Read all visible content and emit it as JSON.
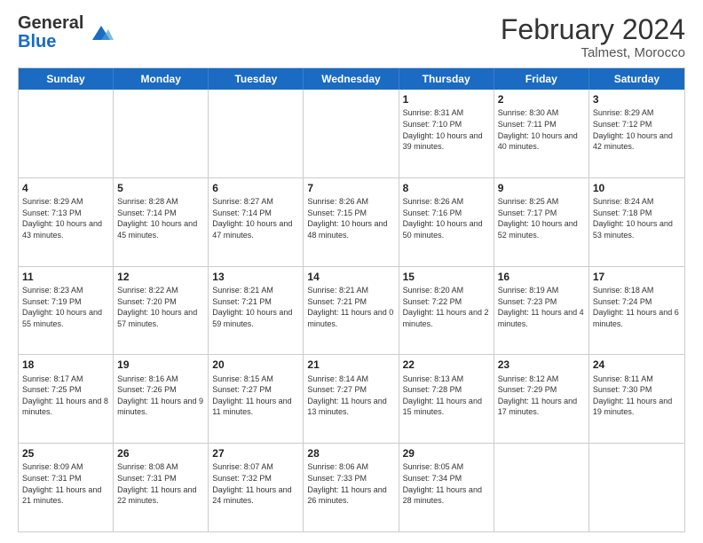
{
  "header": {
    "logo_general": "General",
    "logo_blue": "Blue",
    "title": "February 2024",
    "subtitle": "Talmest, Morocco"
  },
  "calendar": {
    "days": [
      "Sunday",
      "Monday",
      "Tuesday",
      "Wednesday",
      "Thursday",
      "Friday",
      "Saturday"
    ],
    "weeks": [
      [
        {
          "day": "",
          "info": ""
        },
        {
          "day": "",
          "info": ""
        },
        {
          "day": "",
          "info": ""
        },
        {
          "day": "",
          "info": ""
        },
        {
          "day": "1",
          "info": "Sunrise: 8:31 AM\nSunset: 7:10 PM\nDaylight: 10 hours and 39 minutes."
        },
        {
          "day": "2",
          "info": "Sunrise: 8:30 AM\nSunset: 7:11 PM\nDaylight: 10 hours and 40 minutes."
        },
        {
          "day": "3",
          "info": "Sunrise: 8:29 AM\nSunset: 7:12 PM\nDaylight: 10 hours and 42 minutes."
        }
      ],
      [
        {
          "day": "4",
          "info": "Sunrise: 8:29 AM\nSunset: 7:13 PM\nDaylight: 10 hours and 43 minutes."
        },
        {
          "day": "5",
          "info": "Sunrise: 8:28 AM\nSunset: 7:14 PM\nDaylight: 10 hours and 45 minutes."
        },
        {
          "day": "6",
          "info": "Sunrise: 8:27 AM\nSunset: 7:14 PM\nDaylight: 10 hours and 47 minutes."
        },
        {
          "day": "7",
          "info": "Sunrise: 8:26 AM\nSunset: 7:15 PM\nDaylight: 10 hours and 48 minutes."
        },
        {
          "day": "8",
          "info": "Sunrise: 8:26 AM\nSunset: 7:16 PM\nDaylight: 10 hours and 50 minutes."
        },
        {
          "day": "9",
          "info": "Sunrise: 8:25 AM\nSunset: 7:17 PM\nDaylight: 10 hours and 52 minutes."
        },
        {
          "day": "10",
          "info": "Sunrise: 8:24 AM\nSunset: 7:18 PM\nDaylight: 10 hours and 53 minutes."
        }
      ],
      [
        {
          "day": "11",
          "info": "Sunrise: 8:23 AM\nSunset: 7:19 PM\nDaylight: 10 hours and 55 minutes."
        },
        {
          "day": "12",
          "info": "Sunrise: 8:22 AM\nSunset: 7:20 PM\nDaylight: 10 hours and 57 minutes."
        },
        {
          "day": "13",
          "info": "Sunrise: 8:21 AM\nSunset: 7:21 PM\nDaylight: 10 hours and 59 minutes."
        },
        {
          "day": "14",
          "info": "Sunrise: 8:21 AM\nSunset: 7:21 PM\nDaylight: 11 hours and 0 minutes."
        },
        {
          "day": "15",
          "info": "Sunrise: 8:20 AM\nSunset: 7:22 PM\nDaylight: 11 hours and 2 minutes."
        },
        {
          "day": "16",
          "info": "Sunrise: 8:19 AM\nSunset: 7:23 PM\nDaylight: 11 hours and 4 minutes."
        },
        {
          "day": "17",
          "info": "Sunrise: 8:18 AM\nSunset: 7:24 PM\nDaylight: 11 hours and 6 minutes."
        }
      ],
      [
        {
          "day": "18",
          "info": "Sunrise: 8:17 AM\nSunset: 7:25 PM\nDaylight: 11 hours and 8 minutes."
        },
        {
          "day": "19",
          "info": "Sunrise: 8:16 AM\nSunset: 7:26 PM\nDaylight: 11 hours and 9 minutes."
        },
        {
          "day": "20",
          "info": "Sunrise: 8:15 AM\nSunset: 7:27 PM\nDaylight: 11 hours and 11 minutes."
        },
        {
          "day": "21",
          "info": "Sunrise: 8:14 AM\nSunset: 7:27 PM\nDaylight: 11 hours and 13 minutes."
        },
        {
          "day": "22",
          "info": "Sunrise: 8:13 AM\nSunset: 7:28 PM\nDaylight: 11 hours and 15 minutes."
        },
        {
          "day": "23",
          "info": "Sunrise: 8:12 AM\nSunset: 7:29 PM\nDaylight: 11 hours and 17 minutes."
        },
        {
          "day": "24",
          "info": "Sunrise: 8:11 AM\nSunset: 7:30 PM\nDaylight: 11 hours and 19 minutes."
        }
      ],
      [
        {
          "day": "25",
          "info": "Sunrise: 8:09 AM\nSunset: 7:31 PM\nDaylight: 11 hours and 21 minutes."
        },
        {
          "day": "26",
          "info": "Sunrise: 8:08 AM\nSunset: 7:31 PM\nDaylight: 11 hours and 22 minutes."
        },
        {
          "day": "27",
          "info": "Sunrise: 8:07 AM\nSunset: 7:32 PM\nDaylight: 11 hours and 24 minutes."
        },
        {
          "day": "28",
          "info": "Sunrise: 8:06 AM\nSunset: 7:33 PM\nDaylight: 11 hours and 26 minutes."
        },
        {
          "day": "29",
          "info": "Sunrise: 8:05 AM\nSunset: 7:34 PM\nDaylight: 11 hours and 28 minutes."
        },
        {
          "day": "",
          "info": ""
        },
        {
          "day": "",
          "info": ""
        }
      ]
    ]
  }
}
